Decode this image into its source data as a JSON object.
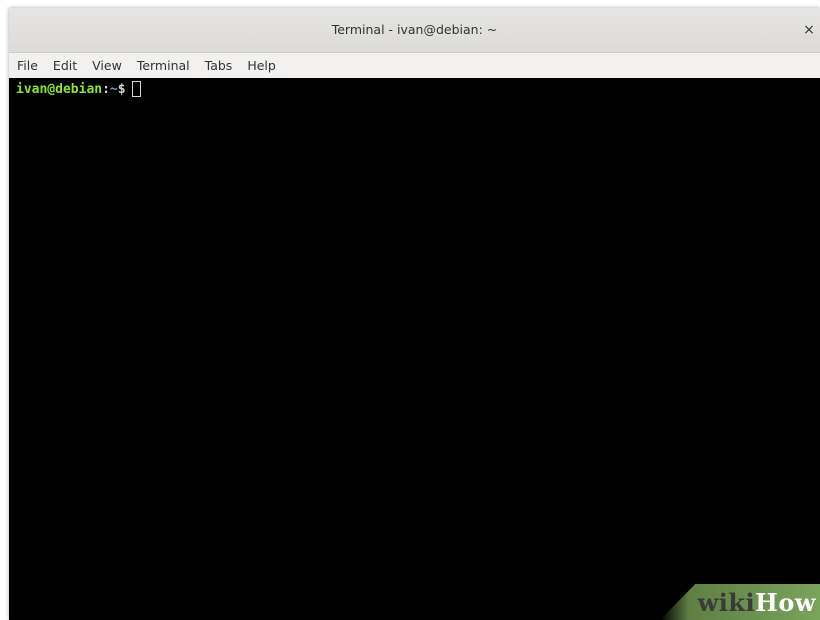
{
  "window": {
    "title": "Terminal - ivan@debian: ~",
    "close_glyph": "×"
  },
  "menubar": {
    "items": [
      "File",
      "Edit",
      "View",
      "Terminal",
      "Tabs",
      "Help"
    ]
  },
  "terminal": {
    "prompt_user_host": "ivan@debian",
    "prompt_separator": ":",
    "prompt_path": "~",
    "prompt_symbol": "$",
    "colors": {
      "background": "#000000",
      "user_host": "#8ae234",
      "path": "#729fcf",
      "text": "#d3d7cf"
    }
  },
  "watermark": {
    "part1": "wiki",
    "part2": "How",
    "color": "#7aa35b"
  }
}
